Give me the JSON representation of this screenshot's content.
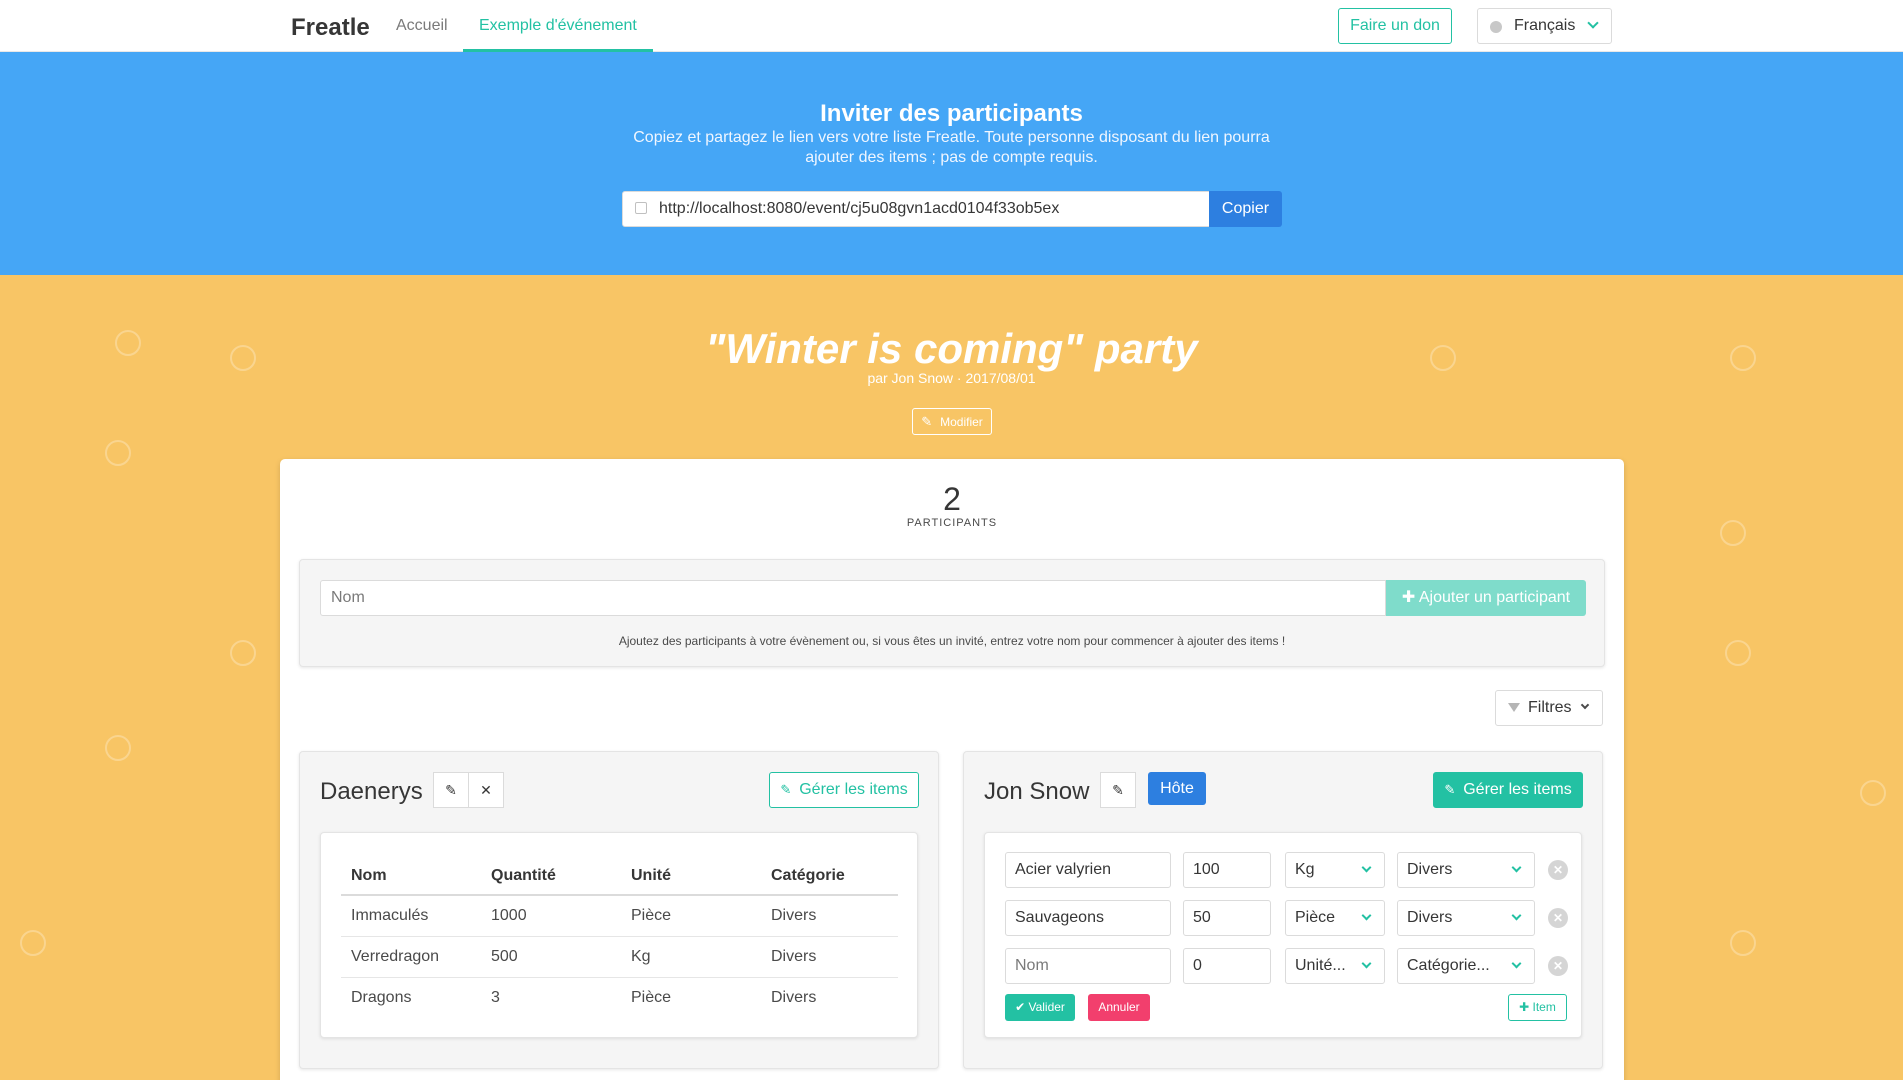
{
  "navbar": {
    "brand": "Freatle",
    "links": [
      {
        "label": "Accueil"
      },
      {
        "label": "Exemple d'événement"
      }
    ],
    "donate_label": "Faire un don",
    "language": "Français"
  },
  "invite": {
    "title": "Inviter des participants",
    "description": "Copiez et partagez le lien vers votre liste Freatle. Toute personne disposant du lien pourra ajouter des items ; pas de compte requis.",
    "link": "http://localhost:8080/event/cj5u08gvn1acd0104f33ob5ex",
    "copy_label": "Copier"
  },
  "event": {
    "title": "\"Winter is coming\" party",
    "meta": "par Jon Snow · 2017/08/01",
    "modify_label": "Modifier"
  },
  "participants": {
    "count": "2",
    "count_label": "PARTICIPANTS",
    "name_placeholder": "Nom",
    "add_label": "Ajouter un participant",
    "hint": "Ajoutez des participants à votre évènement ou, si vous êtes un invité, entrez votre nom pour commencer à ajouter des items !",
    "filter_label": "Filtres"
  },
  "daenerys": {
    "name": "Daenerys",
    "manage_label": "Gérer les items",
    "columns": [
      "Nom",
      "Quantité",
      "Unité",
      "Catégorie"
    ],
    "rows": [
      [
        "Immaculés",
        "1000",
        "Pièce",
        "Divers"
      ],
      [
        "Verredragon",
        "500",
        "Kg",
        "Divers"
      ],
      [
        "Dragons",
        "3",
        "Pièce",
        "Divers"
      ]
    ]
  },
  "jon": {
    "name": "Jon Snow",
    "host_label": "Hôte",
    "manage_label": "Gérer les items",
    "items": [
      {
        "name": "Acier valyrien",
        "qty": "100",
        "unit": "Kg",
        "category": "Divers"
      },
      {
        "name": "Sauvageons",
        "qty": "50",
        "unit": "Pièce",
        "category": "Divers"
      }
    ],
    "new_item": {
      "name_placeholder": "Nom",
      "qty": "0",
      "unit_placeholder": "Unité...",
      "category_placeholder": "Catégorie..."
    },
    "validate_label": "Valider",
    "cancel_label": "Annuler",
    "item_label": "Item"
  },
  "colors": {
    "accent": "#23c1a3",
    "blue": "#45a6f6",
    "host": "#2d7fe0",
    "danger": "#f23f6d",
    "background": "#f8c565"
  }
}
